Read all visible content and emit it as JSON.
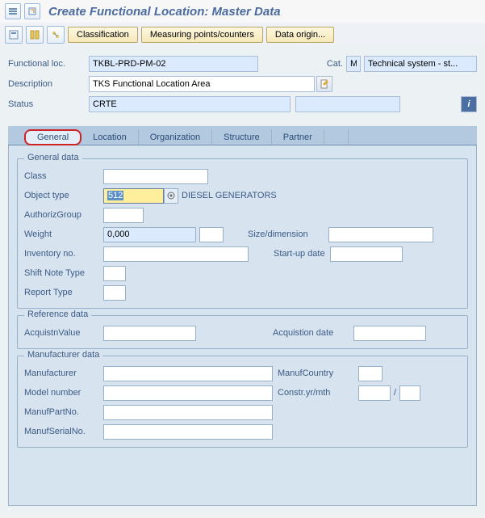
{
  "title": "Create Functional Location: Master Data",
  "toolbar": {
    "classification": "Classification",
    "measuring_points": "Measuring points/counters",
    "data_origin": "Data origin..."
  },
  "header": {
    "func_loc_label": "Functional loc.",
    "func_loc_value": "TKBL-PRD-PM-02",
    "cat_label": "Cat.",
    "cat_value": "M",
    "cat_desc": "Technical system - st...",
    "desc_label": "Description",
    "desc_value": "TKS Functional Location Area",
    "status_label": "Status",
    "status_value": "CRTE"
  },
  "tabs": {
    "general": "General",
    "location": "Location",
    "organization": "Organization",
    "structure": "Structure",
    "partner": "Partner"
  },
  "general_data": {
    "title": "General data",
    "class_label": "Class",
    "object_type_label": "Object type",
    "object_type_value": "512",
    "object_type_desc": "DIESEL GENERATORS",
    "authoriz_label": "AuthorizGroup",
    "weight_label": "Weight",
    "weight_value": "0,000",
    "size_label": "Size/dimension",
    "inventory_label": "Inventory no.",
    "startup_label": "Start-up date",
    "shift_label": "Shift Note Type",
    "report_label": "Report Type"
  },
  "reference_data": {
    "title": "Reference data",
    "acq_value_label": "AcquistnValue",
    "acq_date_label": "Acquistion date"
  },
  "manufacturer_data": {
    "title": "Manufacturer data",
    "manufacturer_label": "Manufacturer",
    "manuf_country_label": "ManufCountry",
    "model_label": "Model number",
    "constr_label": "Constr.yr/mth",
    "constr_sep": "/",
    "part_label": "ManufPartNo.",
    "serial_label": "ManufSerialNo."
  }
}
